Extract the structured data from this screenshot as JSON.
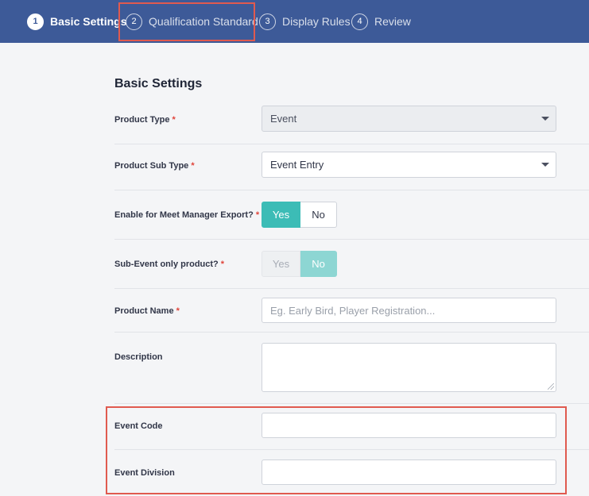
{
  "stepper": {
    "steps": [
      {
        "number": "1",
        "label": "Basic Settings",
        "state": "active"
      },
      {
        "number": "2",
        "label": "Qualification Standard",
        "state": "inactive"
      },
      {
        "number": "3",
        "label": "Display Rules",
        "state": "inactive"
      },
      {
        "number": "4",
        "label": "Review",
        "state": "inactive"
      }
    ]
  },
  "form": {
    "section_title": "Basic Settings",
    "required_mark": "*",
    "product_type": {
      "label": "Product Type",
      "value": "Event",
      "disabled": true
    },
    "product_sub_type": {
      "label": "Product Sub Type",
      "value": "Event Entry"
    },
    "meet_manager_export": {
      "label": "Enable for Meet Manager Export?",
      "yes": "Yes",
      "no": "No",
      "selected": "Yes"
    },
    "sub_event_only": {
      "label": "Sub-Event only product?",
      "yes": "Yes",
      "no": "No",
      "selected": "No",
      "disabled": true
    },
    "product_name": {
      "label": "Product Name",
      "value": "",
      "placeholder": "Eg. Early Bird, Player Registration..."
    },
    "description": {
      "label": "Description",
      "value": ""
    },
    "event_code": {
      "label": "Event Code",
      "value": ""
    },
    "event_division": {
      "label": "Event Division",
      "value": ""
    }
  },
  "colors": {
    "header_bg": "#3d5a98",
    "accent_teal": "#3cbcb6",
    "highlight": "#e05a4f",
    "required": "#e0443a"
  }
}
